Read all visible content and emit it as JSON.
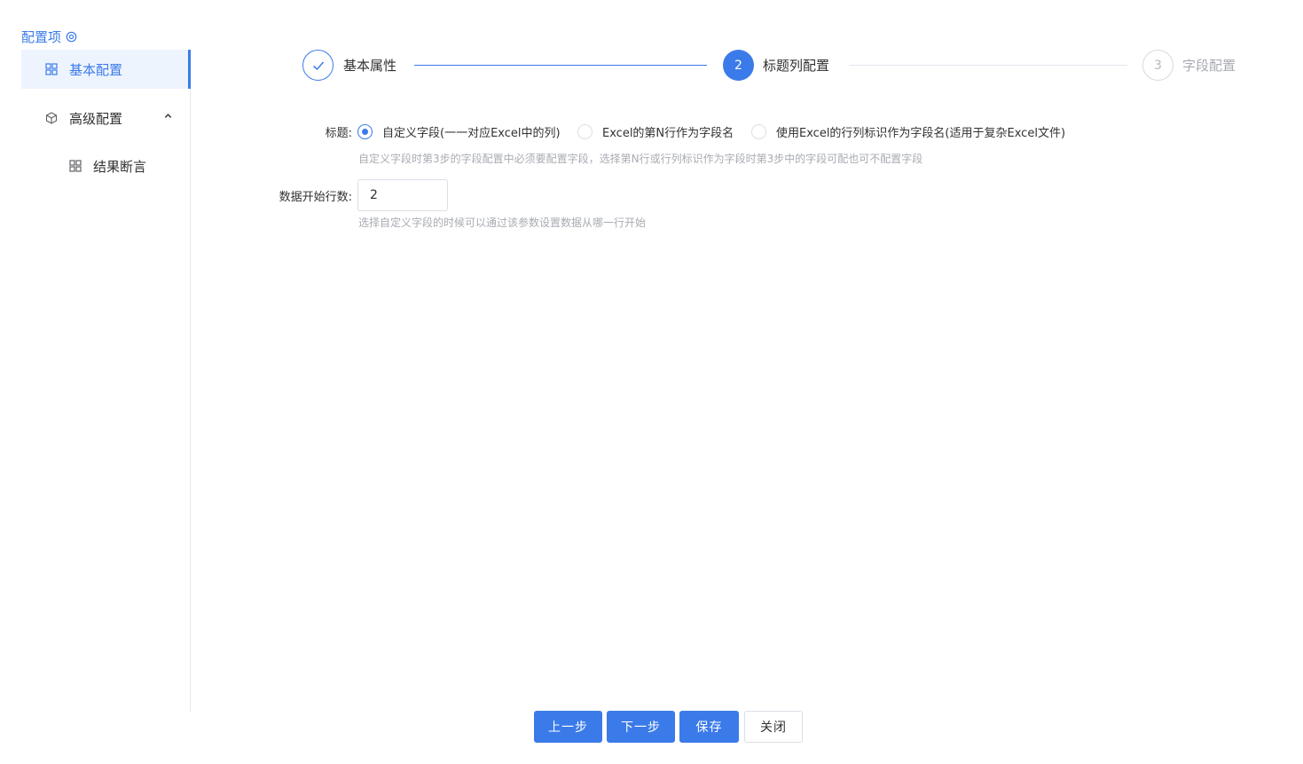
{
  "sidebar": {
    "title": "配置项",
    "items": [
      {
        "label": "基本配置",
        "icon": "grid-icon",
        "active": true
      },
      {
        "label": "高级配置",
        "icon": "cube-icon",
        "expanded": true
      },
      {
        "label": "结果断言",
        "icon": "grid-icon"
      }
    ]
  },
  "steps": [
    {
      "label": "基本属性",
      "status": "done"
    },
    {
      "number": "2",
      "label": "标题列配置",
      "status": "active"
    },
    {
      "number": "3",
      "label": "字段配置",
      "status": "pending"
    }
  ],
  "form": {
    "title_label": "标题:",
    "options": [
      {
        "label": "自定义字段(一一对应Excel中的列)",
        "checked": true
      },
      {
        "label": "Excel的第N行作为字段名",
        "checked": false
      },
      {
        "label": "使用Excel的行列标识作为字段名(适用于复杂Excel文件)",
        "checked": false
      }
    ],
    "title_hint": "自定义字段时第3步的字段配置中必须要配置字段，选择第N行或行列标识作为字段时第3步中的字段可配也可不配置字段",
    "start_row_label": "数据开始行数:",
    "start_row_value": "2",
    "start_row_hint": "选择自定义字段的时候可以通过该参数设置数据从哪一行开始"
  },
  "footer": {
    "prev_label": "上一步",
    "next_label": "下一步",
    "save_label": "保存",
    "close_label": "关闭"
  },
  "colors": {
    "accent": "#3b7be9",
    "active_bg": "#eef4fe",
    "hint": "#a8abb2"
  }
}
